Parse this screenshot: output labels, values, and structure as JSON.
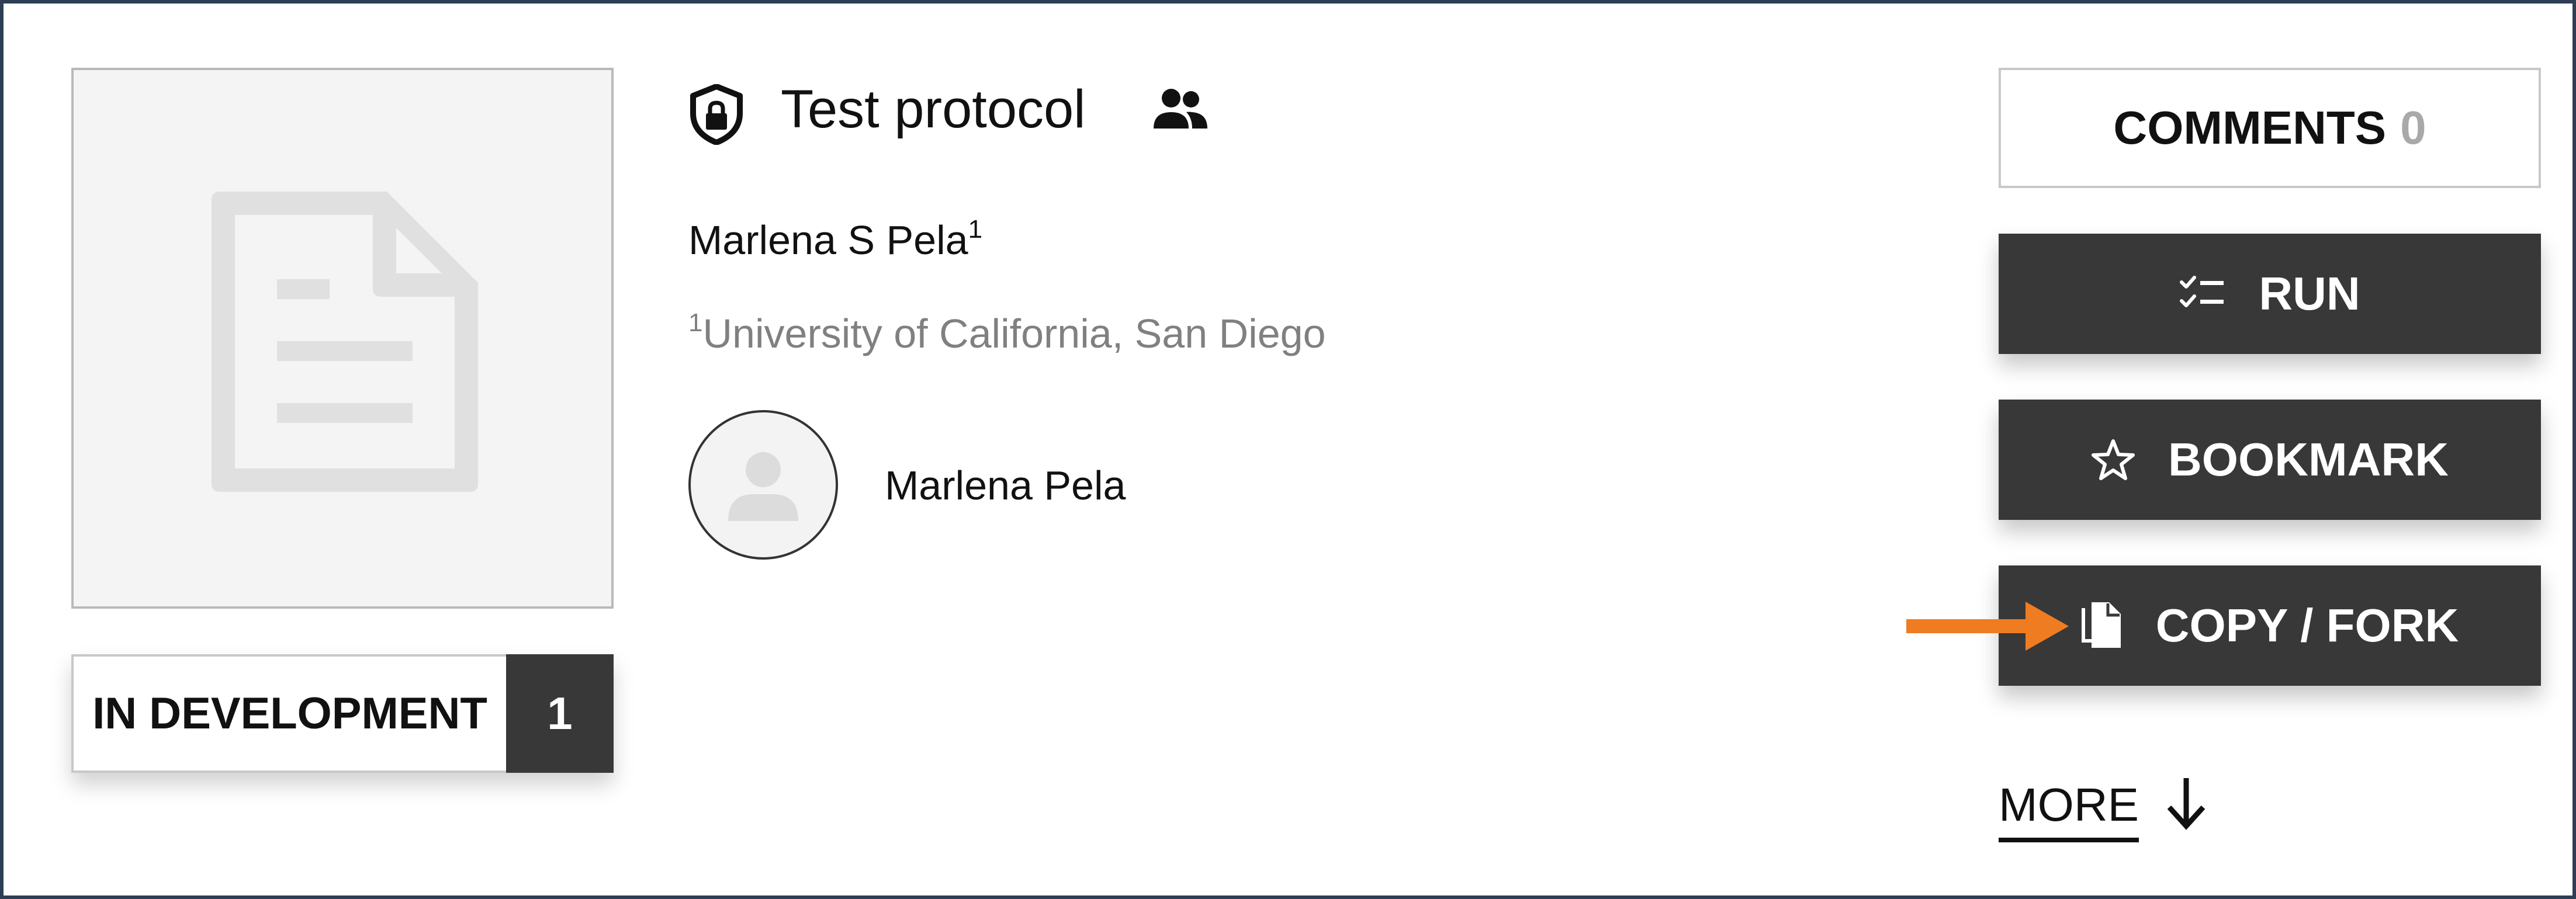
{
  "protocol": {
    "title": "Test protocol",
    "author_name": "Marlena S Pela",
    "author_sup": "1",
    "affiliation_sup": "1",
    "affiliation": "University of California, San Diego",
    "owner_name": "Marlena Pela"
  },
  "status": {
    "label": "IN DEVELOPMENT",
    "count": "1"
  },
  "actions": {
    "comments_label": "COMMENTS",
    "comments_count": "0",
    "run_label": "RUN",
    "bookmark_label": "BOOKMARK",
    "fork_label": "COPY / FORK",
    "more_label": "MORE"
  },
  "icons": {
    "shield": "shield-lock-icon",
    "people": "people-icon",
    "document": "document-icon",
    "avatar": "user-placeholder-icon",
    "run": "checklist-icon",
    "bookmark": "star-icon",
    "fork": "copy-icon",
    "more": "arrow-down-icon",
    "annotation": "orange-arrow-icon"
  },
  "colors": {
    "frame_border": "#2d3e55",
    "dark_button": "#383838",
    "annotation_arrow": "#f07c22",
    "muted_text": "#808080"
  }
}
